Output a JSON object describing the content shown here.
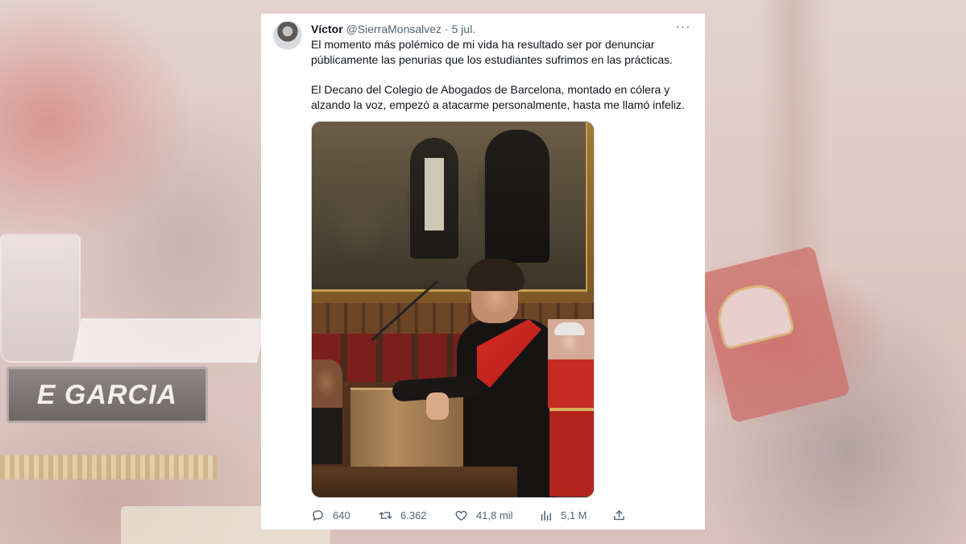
{
  "background": {
    "nameplate_text": "E GARCIA"
  },
  "tweet": {
    "author": {
      "name": "Víctor",
      "handle": "@SierraMonsalvez",
      "separator": "·",
      "date": "5 jul."
    },
    "more_label": "···",
    "body": [
      "El momento más polémico de mi vida ha resultado ser por denunciar públicamente las penurias que los estudiantes sufrimos en las prácticas.",
      "El Decano del Colegio de Abogados de Barcelona, montado en cólera y alzando la voz, empezó a atacarme personalmente, hasta me llamó infeliz."
    ],
    "actions": {
      "replies": "640",
      "retweets": "6.362",
      "likes": "41,8 mil",
      "views": "5,1 M"
    },
    "icons": {
      "reply": "reply-icon",
      "retweet": "retweet-icon",
      "like": "heart-icon",
      "views": "views-chart-icon",
      "share": "share-icon",
      "more": "more-dots-icon"
    },
    "colors": {
      "text": "#0f1419",
      "secondary": "#536471",
      "card": "#ffffff"
    }
  }
}
